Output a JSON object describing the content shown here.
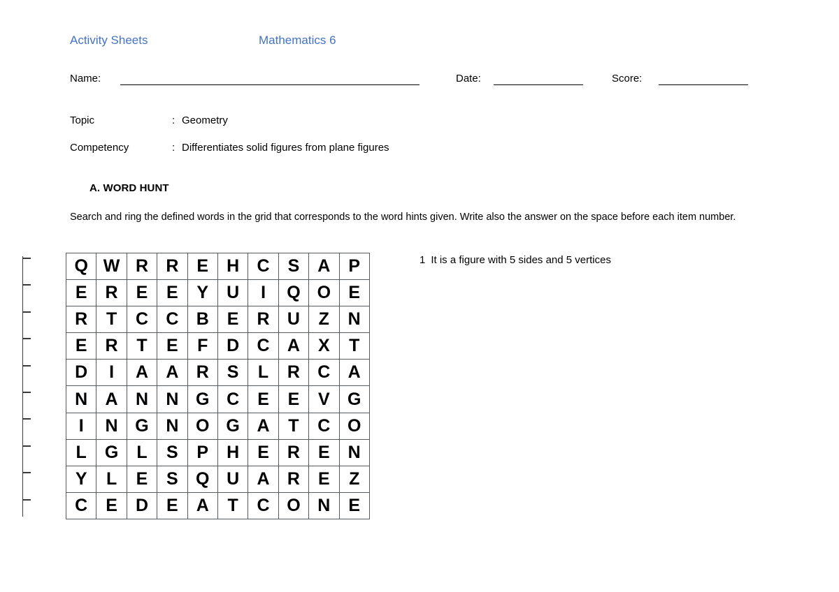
{
  "header": {
    "title": "Activity Sheets",
    "subject": "Mathematics 6",
    "accent_color": "#4472C4"
  },
  "fields": {
    "name_label": "Name:",
    "name_value": "",
    "date_label": "Date:",
    "date_value": "",
    "score_label": "Score:",
    "score_value": ""
  },
  "meta": {
    "topic_key": "Topic",
    "topic_colon": ":",
    "topic_value": "Geometry",
    "competency_key": "Competency",
    "competency_colon": ":",
    "competency_value": "Differentiates solid figures from plane figures"
  },
  "section": {
    "heading": "A.  WORD HUNT",
    "instructions": "Search and ring the defined words in the grid that corresponds to the word hints given. Write also the answer on the space before each item number."
  },
  "grid": {
    "rows": [
      [
        "Q",
        "W",
        "R",
        "R",
        "E",
        "H",
        "C",
        "S",
        "A",
        "P"
      ],
      [
        "E",
        "R",
        "E",
        "E",
        "Y",
        "U",
        "I",
        "Q",
        "O",
        "E"
      ],
      [
        "R",
        "T",
        "C",
        "C",
        "B",
        "E",
        "R",
        "U",
        "Z",
        "N"
      ],
      [
        "E",
        "R",
        "T",
        "E",
        "F",
        "D",
        "C",
        "A",
        "X",
        "T"
      ],
      [
        "D",
        "I",
        "A",
        "A",
        "R",
        "S",
        "L",
        "R",
        "C",
        "A"
      ],
      [
        "N",
        "A",
        "N",
        "N",
        "G",
        "C",
        "E",
        "E",
        "V",
        "G"
      ],
      [
        "I",
        "N",
        "G",
        "N",
        "O",
        "G",
        "A",
        "T",
        "C",
        "O"
      ],
      [
        "L",
        "G",
        "L",
        "S",
        "P",
        "H",
        "E",
        "R",
        "E",
        "N"
      ],
      [
        "Y",
        "L",
        "E",
        "S",
        "Q",
        "U",
        "A",
        "R",
        "E",
        "Z"
      ],
      [
        "C",
        "E",
        "D",
        "E",
        "A",
        "T",
        "C",
        "O",
        "N",
        "E"
      ]
    ]
  },
  "questions": [
    {
      "number": "1",
      "text": "It is a figure with 5 sides and 5 vertices"
    }
  ],
  "answer_line_count": 10
}
